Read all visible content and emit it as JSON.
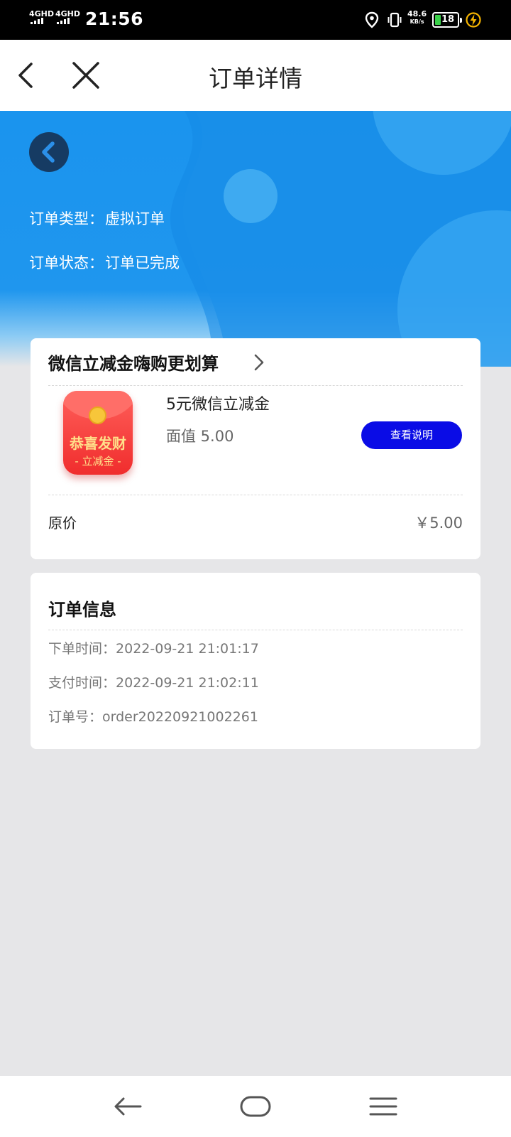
{
  "status_bar": {
    "sim1": "4GHD",
    "sim2": "4GHD",
    "time": "21:56",
    "net_speed": "48.6",
    "net_speed_unit": "KB/s",
    "battery": "18"
  },
  "header": {
    "title": "订单详情"
  },
  "hero": {
    "order_type_label": "订单类型：",
    "order_type_value": "虚拟订单",
    "order_status_label": "订单状态：",
    "order_status_value": "订单已完成"
  },
  "product_card": {
    "shop_title": "微信立减金嗨购更划算",
    "image_title": "恭喜发财",
    "image_subtitle": "- 立减金 -",
    "product_name": "5元微信立减金",
    "face_value": "面值 5.00",
    "detail_button": "查看说明",
    "original_price_label": "原价",
    "original_price_value": "￥5.00"
  },
  "order_info": {
    "title": "订单信息",
    "rows": [
      {
        "label": "下单时间：",
        "value": "2022-09-21 21:01:17"
      },
      {
        "label": "支付时间：",
        "value": "2022-09-21 21:02:11"
      },
      {
        "label": "订单号：",
        "value": "order20220921002261"
      }
    ]
  },
  "colors": {
    "hero_blue": "#1a94ee",
    "button_blue": "#0a0ce6",
    "envelope_red": "#f02d2d",
    "battery_green": "#3bd24a"
  }
}
